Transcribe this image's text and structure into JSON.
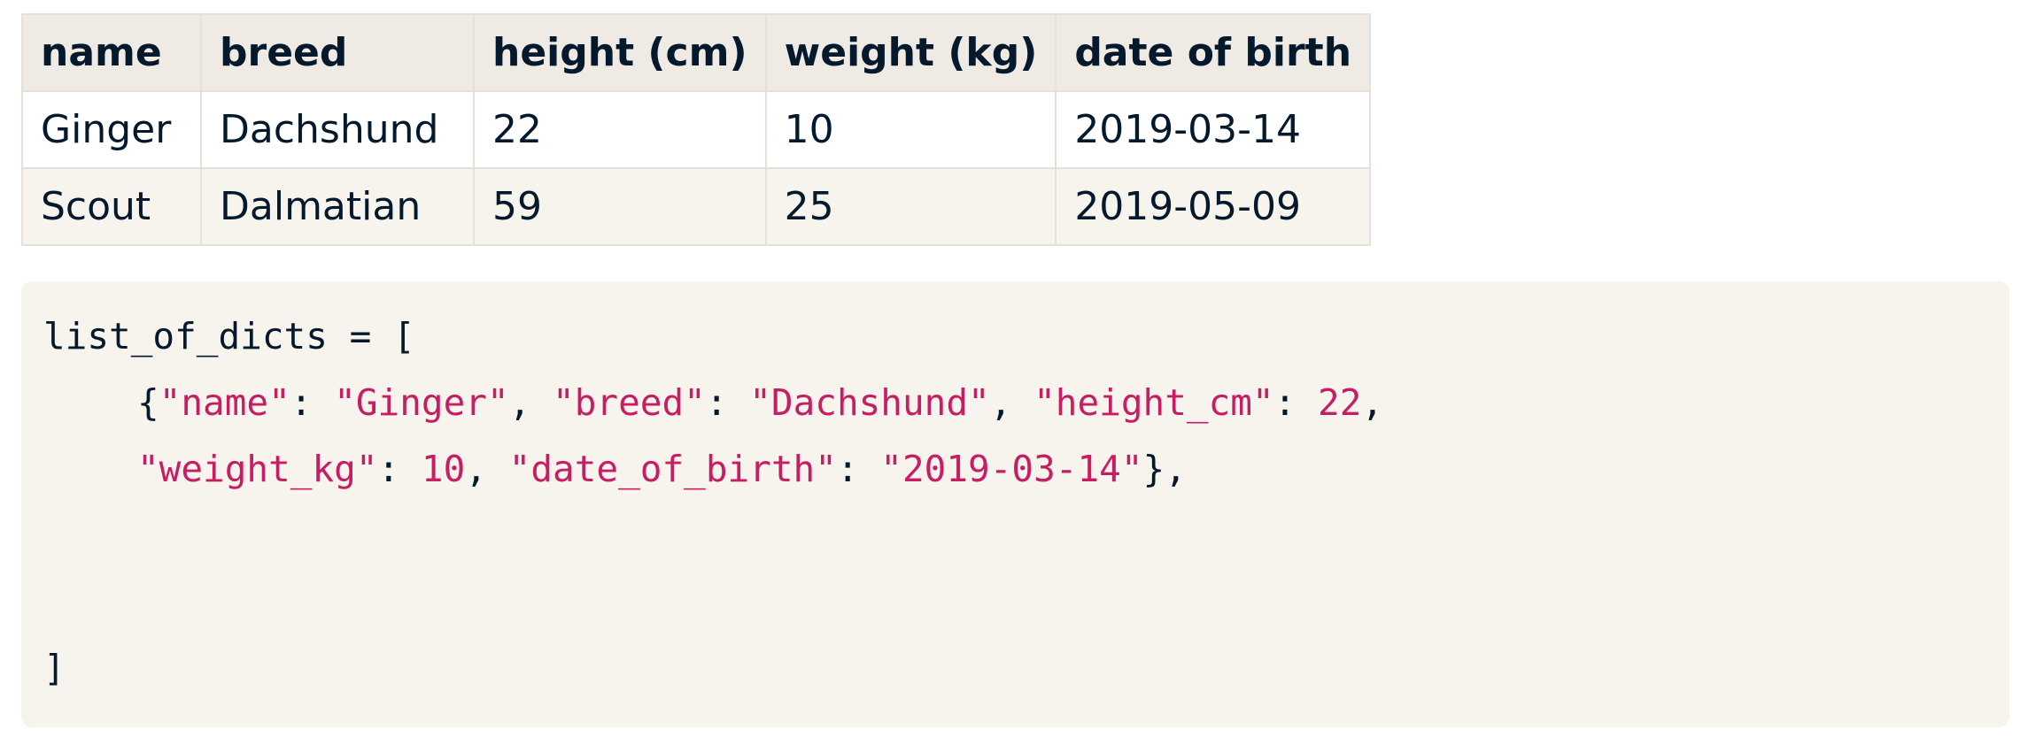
{
  "table": {
    "headers": [
      "name",
      "breed",
      "height (cm)",
      "weight (kg)",
      "date of birth"
    ],
    "rows": [
      [
        "Ginger",
        "Dachshund",
        "22",
        "10",
        "2019-03-14"
      ],
      [
        "Scout",
        "Dalmatian",
        "59",
        "25",
        "2019-05-09"
      ]
    ]
  },
  "code": {
    "line1": "list_of_dicts = [",
    "line2": {
      "open_brace": "{",
      "k_name": "\"name\"",
      "sep1": ": ",
      "v_name": "\"Ginger\"",
      "comma1": ", ",
      "k_breed": "\"breed\"",
      "sep2": ": ",
      "v_breed": "\"Dachshund\"",
      "comma2": ", ",
      "k_height": "\"height_cm\"",
      "sep3": ": ",
      "v_height": "22",
      "comma3": ","
    },
    "line3": {
      "k_weight": "\"weight_kg\"",
      "sep1": ": ",
      "v_weight": "10",
      "comma1": ", ",
      "k_dob": "\"date_of_birth\"",
      "sep2": ": ",
      "v_dob": "\"2019-03-14\"",
      "close": "},"
    },
    "line4": "]"
  },
  "colors": {
    "text": "#05192d",
    "string": "#c71e63",
    "header_bg": "#efebe4",
    "code_bg": "#f7f3ed"
  }
}
